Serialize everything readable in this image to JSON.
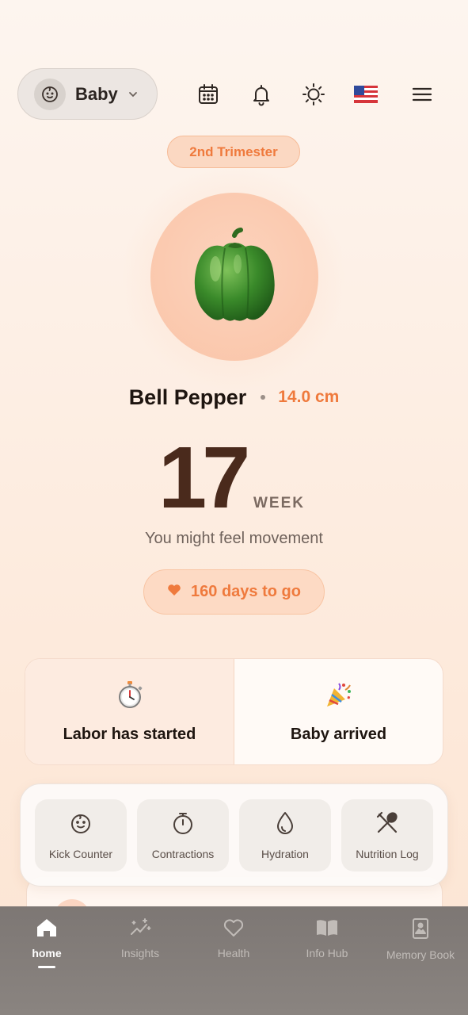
{
  "header": {
    "baby_selector": {
      "label": "Baby"
    },
    "icons": [
      "calendar-icon",
      "bell-icon",
      "sun-icon",
      "us-flag-icon",
      "menu-icon"
    ]
  },
  "trimester": {
    "label": "2nd Trimester"
  },
  "fruit": {
    "name": "Bell Pepper",
    "size": "14.0 cm",
    "icon": "bell-pepper"
  },
  "week": {
    "number": "17",
    "unit": "WEEK",
    "description": "You might feel movement"
  },
  "countdown": {
    "label": "160 days to go"
  },
  "events": [
    {
      "label": "Labor has started",
      "icon": "stopwatch-icon"
    },
    {
      "label": "Baby arrived",
      "icon": "party-popper-icon"
    }
  ],
  "quick_actions": [
    {
      "label": "Kick Counter",
      "icon": "baby-face-icon"
    },
    {
      "label": "Contractions",
      "icon": "timer-icon"
    },
    {
      "label": "Hydration",
      "icon": "droplet-icon"
    },
    {
      "label": "Nutrition Log",
      "icon": "utensils-icon"
    }
  ],
  "nav": {
    "items": [
      {
        "label": "home",
        "icon": "home-icon",
        "active": true
      },
      {
        "label": "Insights",
        "icon": "sparkle-chart-icon"
      },
      {
        "label": "Health",
        "icon": "heart-icon"
      },
      {
        "label": "Info Hub",
        "icon": "book-icon"
      },
      {
        "label": "Memory Book",
        "icon": "photo-book-icon"
      }
    ]
  },
  "colors": {
    "accent": "#ef7a3d",
    "week_number": "#4a2a1c",
    "background": "#fdf0e6",
    "nav_background": "#827c79"
  }
}
